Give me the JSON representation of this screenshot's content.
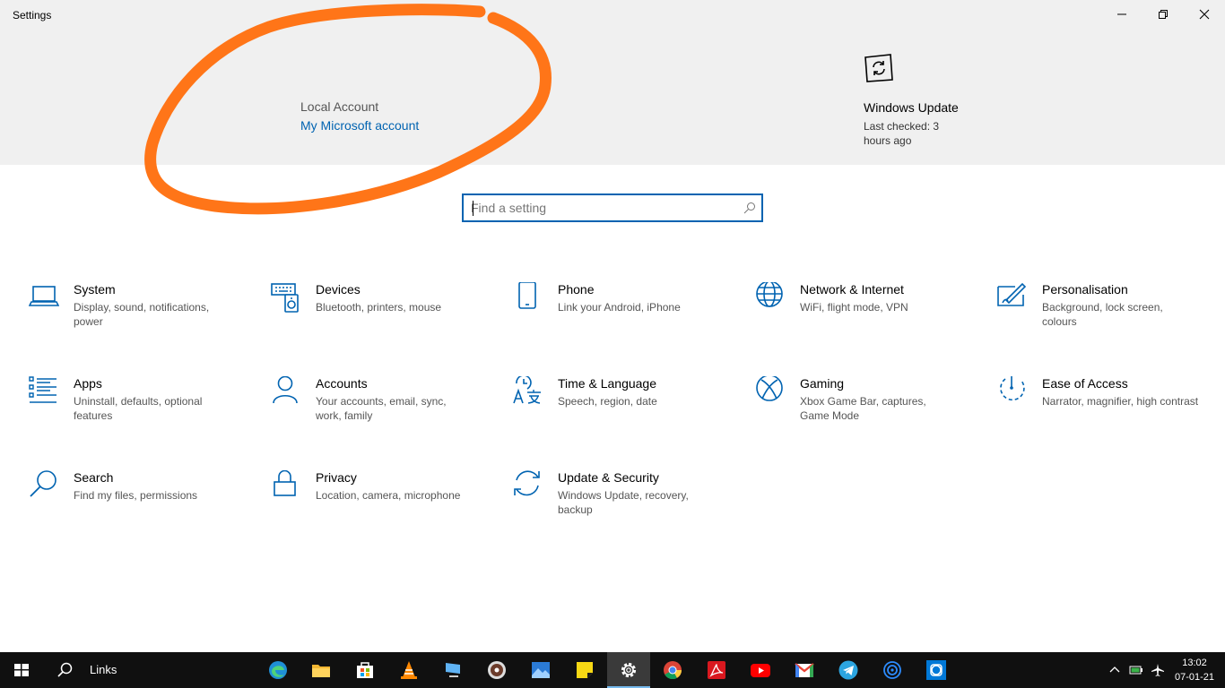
{
  "window": {
    "title": "Settings",
    "controls": [
      "minimize",
      "restore",
      "close"
    ]
  },
  "header": {
    "account_type": "Local Account",
    "account_link": "My Microsoft account",
    "windows_update": {
      "title": "Windows Update",
      "subtitle": "Last checked: 3 hours ago"
    }
  },
  "search": {
    "placeholder": "Find a setting",
    "value": ""
  },
  "categories": [
    {
      "name": "System",
      "desc": "Display, sound, notifications, power",
      "icon": "laptop-icon"
    },
    {
      "name": "Devices",
      "desc": "Bluetooth, printers, mouse",
      "icon": "devices-icon"
    },
    {
      "name": "Phone",
      "desc": "Link your Android, iPhone",
      "icon": "phone-icon"
    },
    {
      "name": "Network & Internet",
      "desc": "WiFi, flight mode, VPN",
      "icon": "globe-icon"
    },
    {
      "name": "Personalisation",
      "desc": "Background, lock screen, colours",
      "icon": "paint-icon"
    },
    {
      "name": "Apps",
      "desc": "Uninstall, defaults, optional features",
      "icon": "apps-list-icon"
    },
    {
      "name": "Accounts",
      "desc": "Your accounts, email, sync, work, family",
      "icon": "person-icon"
    },
    {
      "name": "Time & Language",
      "desc": "Speech, region, date",
      "icon": "time-language-icon"
    },
    {
      "name": "Gaming",
      "desc": "Xbox Game Bar, captures, Game Mode",
      "icon": "xbox-icon"
    },
    {
      "name": "Ease of Access",
      "desc": "Narrator, magnifier, high contrast",
      "icon": "ease-of-access-icon"
    },
    {
      "name": "Search",
      "desc": "Find my files, permissions",
      "icon": "search-icon"
    },
    {
      "name": "Privacy",
      "desc": "Location, camera, microphone",
      "icon": "lock-icon"
    },
    {
      "name": "Update & Security",
      "desc": "Windows Update, recovery, backup",
      "icon": "refresh-icon"
    }
  ],
  "taskbar": {
    "search_label": "Links",
    "apps": [
      "edge-icon",
      "file-explorer-icon",
      "store-icon",
      "vlc-icon",
      "pc-icon",
      "media-player-icon",
      "photos-icon",
      "sticky-notes-icon",
      "settings-icon",
      "chrome-icon",
      "acrobat-icon",
      "youtube-icon",
      "gmail-icon",
      "telegram-icon",
      "network-app-icon",
      "app-icon"
    ],
    "time": "13:02",
    "date": "07-01-21"
  },
  "colors": {
    "accent": "#0063b1",
    "header_bg": "#f0f0f0",
    "annotation": "#ff7518",
    "taskbar_bg": "#101010"
  }
}
